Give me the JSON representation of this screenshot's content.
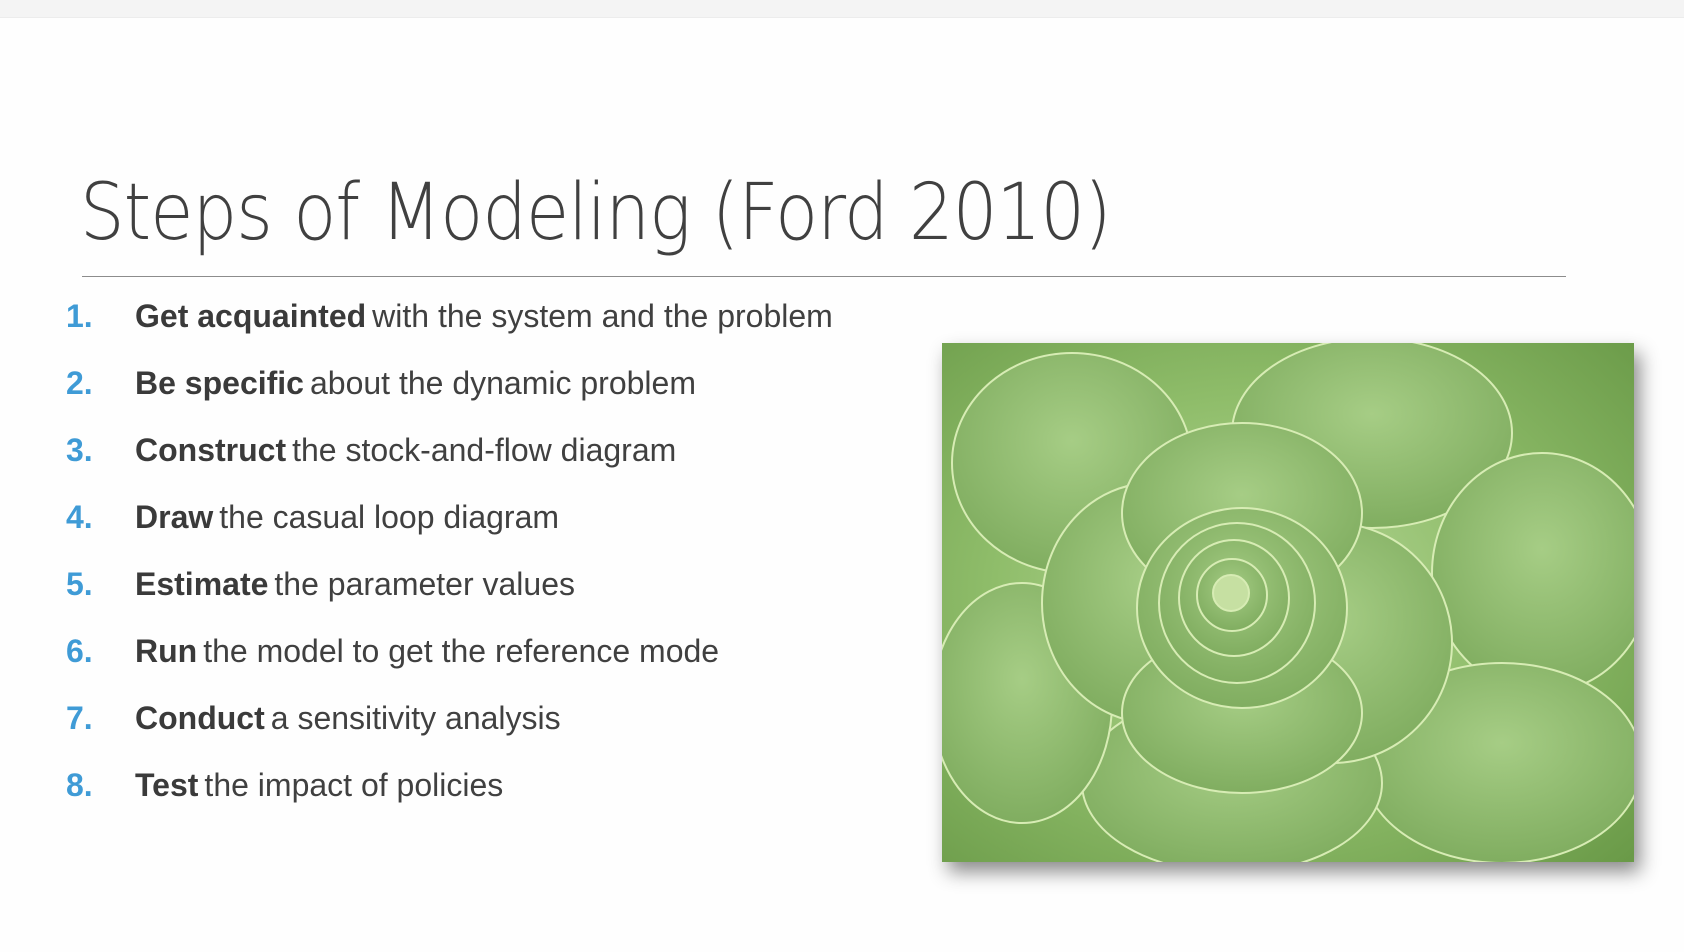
{
  "slide": {
    "title": "Steps of Modeling (Ford 2010)",
    "steps": [
      {
        "number": "1.",
        "bold": "Get acquainted",
        "rest": "with the system and the problem"
      },
      {
        "number": "2.",
        "bold": "Be specific",
        "rest": "about the dynamic problem"
      },
      {
        "number": "3.",
        "bold": "Construct",
        "rest": "the stock-and-flow diagram"
      },
      {
        "number": "4.",
        "bold": "Draw",
        "rest": "the casual loop diagram"
      },
      {
        "number": "5.",
        "bold": "Estimate",
        "rest": "the parameter values"
      },
      {
        "number": "6.",
        "bold": "Run",
        "rest": "the model to get the reference mode"
      },
      {
        "number": "7.",
        "bold": "Conduct",
        "rest": "a sensitivity analysis"
      },
      {
        "number": "8.",
        "bold": "Test",
        "rest": "the impact of policies"
      }
    ],
    "image": {
      "description": "succulent-rosette-photo",
      "alt": "Green succulent rosette"
    }
  },
  "colors": {
    "accent": "#3f9bd6",
    "text": "#404040",
    "leaf_light": "#a9cf84",
    "leaf_dark": "#6f9e4e"
  }
}
